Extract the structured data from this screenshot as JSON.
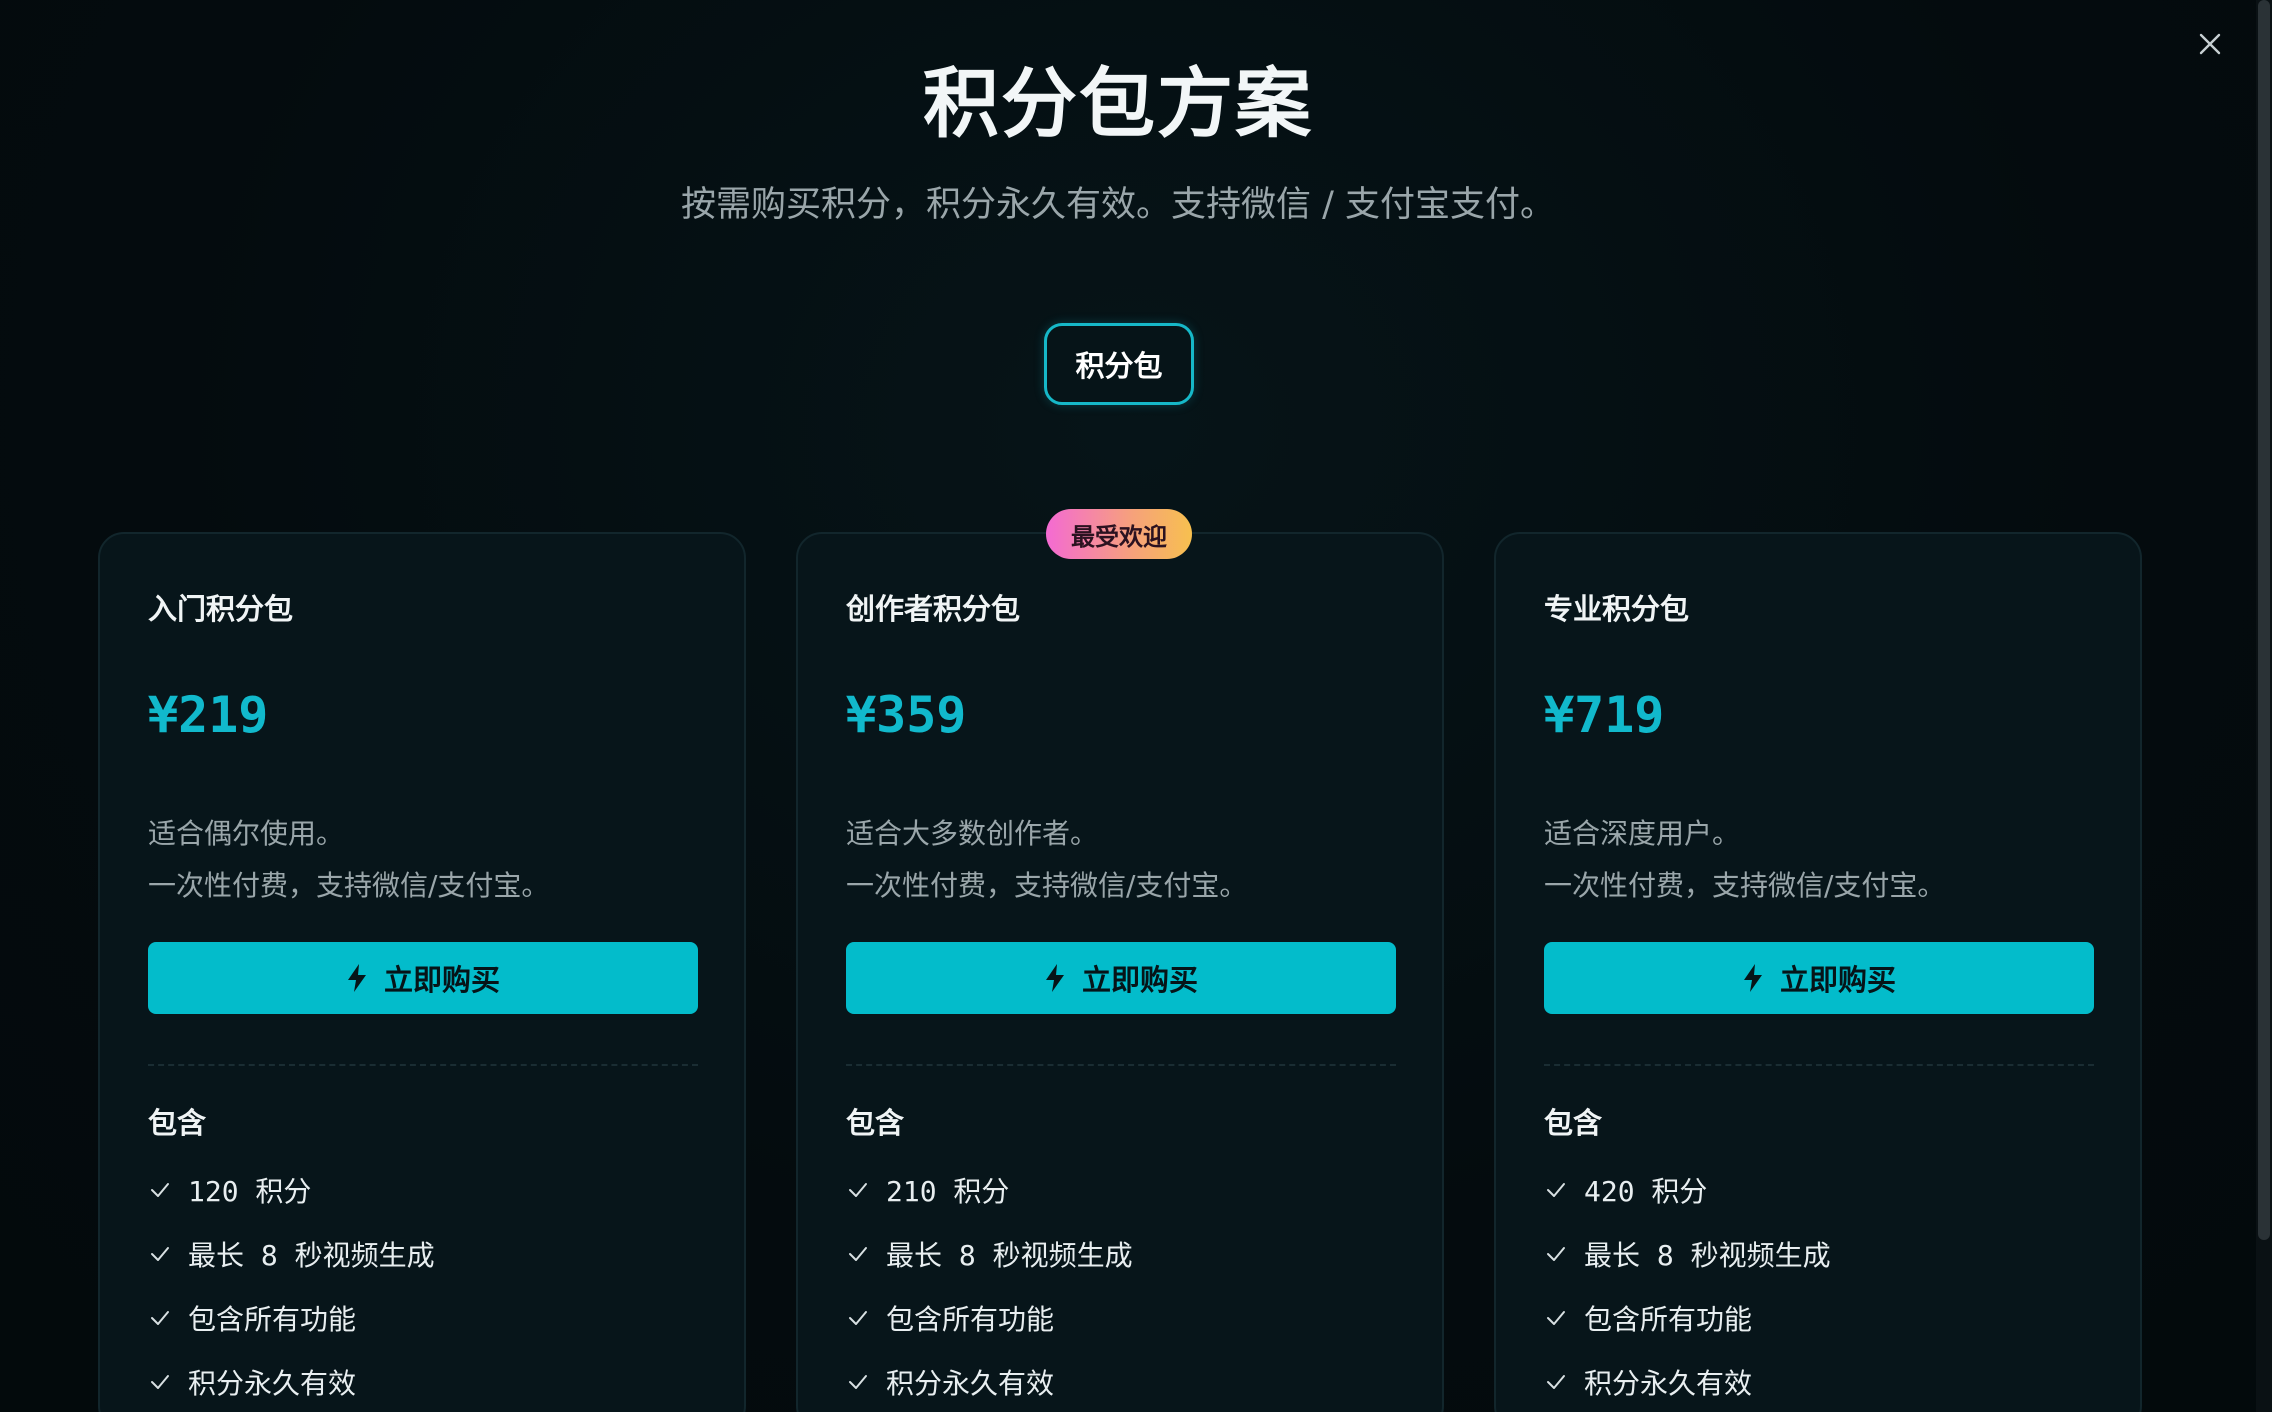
{
  "page": {
    "title": "积分包方案",
    "subtitle": "按需购买积分，积分永久有效。支持微信 / 支付宝支付。",
    "close_icon": "close-icon"
  },
  "tabs": [
    {
      "label": "积分包",
      "active": true
    }
  ],
  "colors": {
    "accent": "#03bccb",
    "price": "#11b9cc",
    "background": "#040c0f"
  },
  "plans": [
    {
      "name": "入门积分包",
      "price": "¥219",
      "desc_line1": "适合偶尔使用。",
      "desc_line2": "一次性付费，支持微信/支付宝。",
      "button_label": "立即购买",
      "includes_label": "包含",
      "features": [
        "120 积分",
        "最长 8 秒视频生成",
        "包含所有功能",
        "积分永久有效"
      ]
    },
    {
      "name": "创作者积分包",
      "badge": "最受欢迎",
      "price": "¥359",
      "desc_line1": "适合大多数创作者。",
      "desc_line2": "一次性付费，支持微信/支付宝。",
      "button_label": "立即购买",
      "includes_label": "包含",
      "features": [
        "210 积分",
        "最长 8 秒视频生成",
        "包含所有功能",
        "积分永久有效"
      ]
    },
    {
      "name": "专业积分包",
      "price": "¥719",
      "desc_line1": "适合深度用户。",
      "desc_line2": "一次性付费，支持微信/支付宝。",
      "button_label": "立即购买",
      "includes_label": "包含",
      "features": [
        "420 积分",
        "最长 8 秒视频生成",
        "包含所有功能",
        "积分永久有效"
      ]
    }
  ]
}
